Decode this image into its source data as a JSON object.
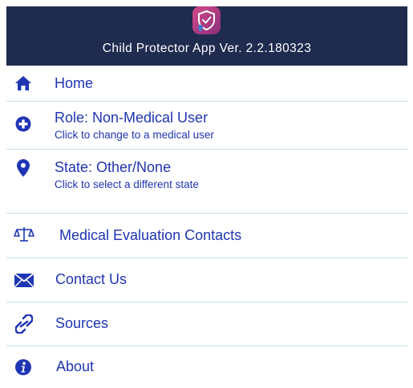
{
  "header": {
    "title": "Child Protector App Ver. 2.2.180323",
    "background": "#1f2b4f",
    "icon": "app-shield-icon"
  },
  "menu": {
    "accent_color": "#1f35b4",
    "items": [
      {
        "id": "home",
        "label": "Home",
        "icon": "home-icon"
      },
      {
        "id": "role",
        "label": "Role: Non-Medical User",
        "sublabel": "Click to change to a medical user",
        "icon": "plus-circle-icon"
      },
      {
        "id": "state",
        "label": "State: Other/None",
        "sublabel": "Click to select a different state",
        "icon": "location-pin-icon"
      },
      {
        "id": "medical",
        "label": "Medical Evaluation Contacts",
        "icon": "scales-icon"
      },
      {
        "id": "contact",
        "label": "Contact Us",
        "icon": "envelope-icon"
      },
      {
        "id": "sources",
        "label": "Sources",
        "icon": "link-icon"
      },
      {
        "id": "about",
        "label": "About",
        "icon": "info-icon"
      }
    ]
  }
}
